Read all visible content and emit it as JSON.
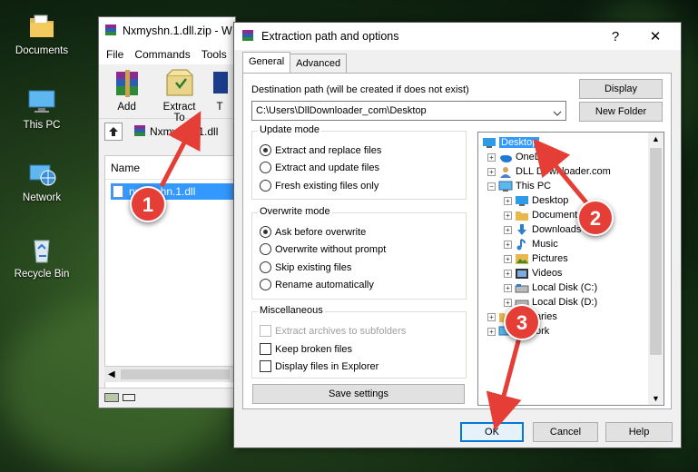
{
  "desktop": {
    "icons": [
      {
        "label": "Documents",
        "icon": "folder-documents-icon"
      },
      {
        "label": "This PC",
        "icon": "computer-icon"
      },
      {
        "label": "Network",
        "icon": "network-globe-icon"
      },
      {
        "label": "Recycle Bin",
        "icon": "recycle-bin-icon"
      }
    ]
  },
  "winrar": {
    "title": "Nxmyshn.1.dll.zip - W",
    "menu": [
      "File",
      "Commands",
      "Tools"
    ],
    "toolbar": {
      "add_label": "Add",
      "extract_label": "Extract To",
      "third_label": "T"
    },
    "address": "Nxmyshn.1.dll",
    "list_header": "Name",
    "selected_file": "nxmyshn.1.dll"
  },
  "dialog": {
    "title": "Extraction path and options",
    "help_glyph": "?",
    "close_glyph": "✕",
    "tabs": [
      "General",
      "Advanced"
    ],
    "destination_label": "Destination path (will be created if does not exist)",
    "destination_value": "C:\\Users\\DllDownloader_com\\Desktop",
    "display_button": "Display",
    "new_folder_button": "New Folder",
    "update_mode": {
      "title": "Update mode",
      "options": [
        "Extract and replace files",
        "Extract and update files",
        "Fresh existing files only"
      ],
      "selected": 0
    },
    "overwrite_mode": {
      "title": "Overwrite mode",
      "options": [
        "Ask before overwrite",
        "Overwrite without prompt",
        "Skip existing files",
        "Rename automatically"
      ],
      "selected": 0
    },
    "misc": {
      "title": "Miscellaneous",
      "options": [
        "Extract archives to subfolders",
        "Keep broken files",
        "Display files in Explorer"
      ]
    },
    "save_settings": "Save settings",
    "tree": [
      {
        "label": "Desktop",
        "icon": "desktop-icon",
        "selected": true
      },
      {
        "label": "OneDrive",
        "icon": "onedrive-icon"
      },
      {
        "label": "DLL Downloader.com",
        "icon": "user-icon"
      },
      {
        "label": "This PC",
        "icon": "computer-icon"
      },
      {
        "label": "Desktop",
        "icon": "desktop-icon"
      },
      {
        "label": "Documents",
        "icon": "folder-documents-icon"
      },
      {
        "label": "Downloads",
        "icon": "download-icon"
      },
      {
        "label": "Music",
        "icon": "music-icon"
      },
      {
        "label": "Pictures",
        "icon": "pictures-icon"
      },
      {
        "label": "Videos",
        "icon": "videos-icon"
      },
      {
        "label": "Local Disk (C:)",
        "icon": "drive-icon"
      },
      {
        "label": "Local Disk (D:)",
        "icon": "drive-icon"
      },
      {
        "label": "aries",
        "icon": "libraries-icon"
      },
      {
        "label": "ork",
        "icon": "network-icon"
      }
    ],
    "ok": "OK",
    "cancel": "Cancel",
    "help": "Help"
  },
  "annotations": [
    "1",
    "2",
    "3"
  ],
  "colors": {
    "annotation": "#e53e36",
    "selection": "#3399ff",
    "focus": "#0078d7"
  }
}
